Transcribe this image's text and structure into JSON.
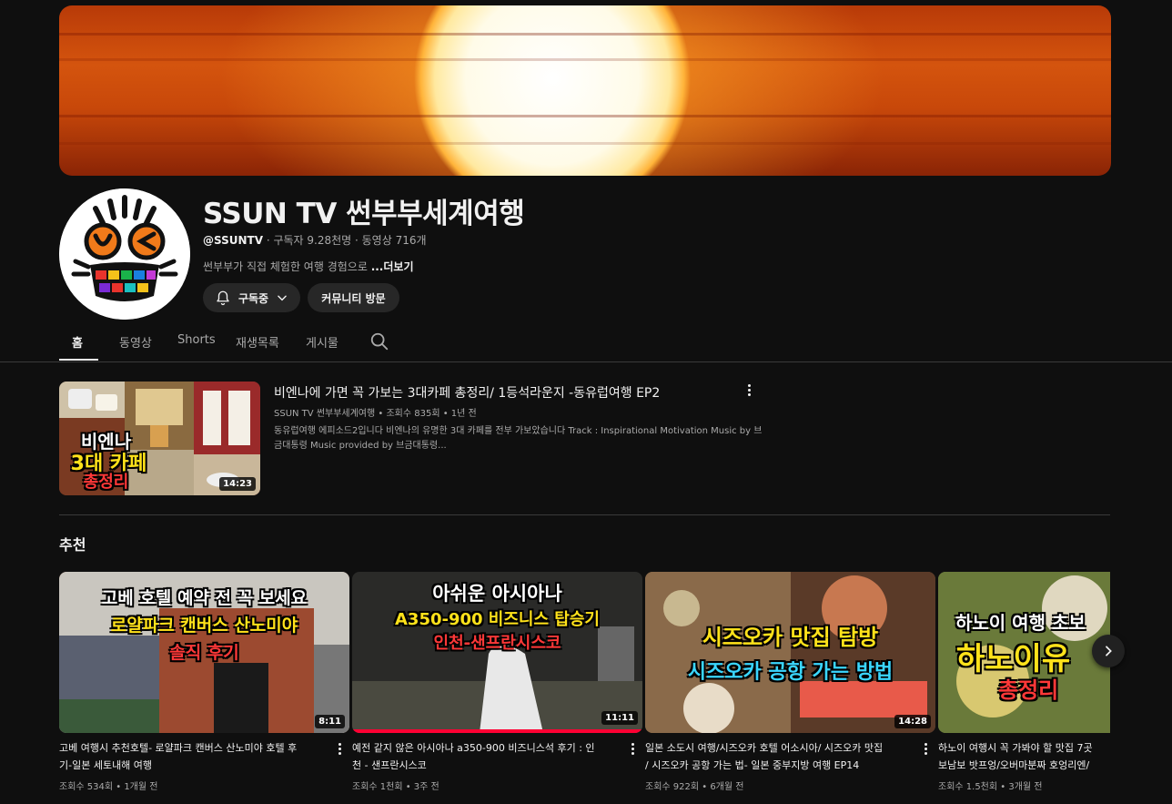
{
  "channel": {
    "name": "SSUN TV 썬부부세계여행",
    "handle": "@SSUNTV",
    "stats": " · 구독자 9.28천명 · 동영상 716개",
    "description": "썬부부가 직접 체험한 여행 경험으로 ",
    "more_label": "...더보기"
  },
  "buttons": {
    "subscribed_label": "구독중",
    "community_label": "커뮤니티 방문"
  },
  "tabs": [
    {
      "label": "홈",
      "active": true
    },
    {
      "label": "동영상"
    },
    {
      "label": "Shorts"
    },
    {
      "label": "재생목록"
    },
    {
      "label": "게시물"
    }
  ],
  "featured": {
    "title": "비엔나에 가면 꼭 가보는 3대카페 총정리/ 1등석라운지 -동유럽여행 EP2",
    "meta": "SSUN TV 썬부부세계여행 • 조회수 835회 • 1년 전",
    "description": "동유럽여행 에피소드2입니다 비엔나의 유명한 3대 카페를 전부 가보았습니다 Track : Inspirational Motivation Music by 브금대통령 Music provided by 브금대통령...",
    "duration": "14:23",
    "thumb_lines": [
      "비엔나",
      "3대 카페",
      "총정리"
    ]
  },
  "section_title": "추천",
  "cards": [
    {
      "title_line1": "고베 여행시 추천호텔- 로얄파크 캔버스 산노미야 호텔 후",
      "title_line2": "기-일본 세토내해 여행",
      "meta": "조회수 534회 • 1개월 전",
      "duration": "8:11",
      "thumb_lines": [
        "고베 호텔 예약 전 꼭 보세요",
        "로얄파크 캔버스 산노미야",
        "솔직 후기"
      ]
    },
    {
      "title_line1": "예전 같지 않은 아시아나 a350-900 비즈니스석 후기 : 인",
      "title_line2": "천 - 샌프란시스코",
      "meta": "조회수 1천회 • 3주 전",
      "duration": "11:11",
      "watched_fraction": 1.0,
      "thumb_lines": [
        "아쉬운 아시아나",
        "A350-900 비즈니스 탑승기",
        "인천-샌프란시스코"
      ]
    },
    {
      "title_line1": "일본 소도시 여행/시즈오카 호텔 어소시아/ 시즈오카 맛집",
      "title_line2": "/ 시즈오카 공항 가는 법- 일본 중부지방 여행 EP14",
      "meta": "조회수 922회 • 6개월 전",
      "duration": "14:28",
      "thumb_lines": [
        "시즈오카 맛집 탐방",
        "시즈오카 공항 가는 방법"
      ]
    },
    {
      "title_line1": "하노이 여행시 꼭 가봐야 할 맛집 7곳",
      "title_line2": "보남보 밧프엉/오버마분짜 호엉리엔/",
      "meta": "조회수 1.5천회 • 3개월 전",
      "thumb_lines": [
        "하노이 여행 초보",
        "하노이유",
        "총정리"
      ]
    }
  ],
  "colors": {
    "background": "#0f0f0f",
    "chip": "#272727",
    "progress": "#ff0033",
    "muted_text": "#aaaaaa"
  },
  "icons": [
    "bell-icon",
    "chevron-down-icon",
    "search-icon",
    "kebab-icon",
    "chevron-right-icon"
  ]
}
